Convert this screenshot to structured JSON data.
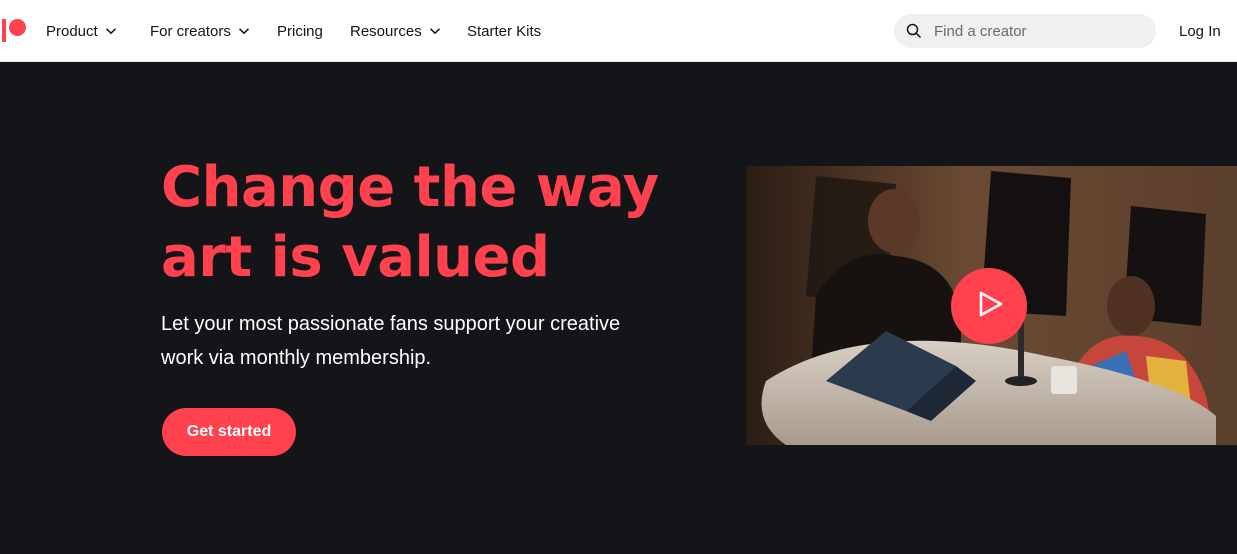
{
  "nav": {
    "brand": "Patreon",
    "items": [
      {
        "label": "Product",
        "has_dropdown": true
      },
      {
        "label": "For creators",
        "has_dropdown": true
      },
      {
        "label": "Pricing",
        "has_dropdown": false
      },
      {
        "label": "Resources",
        "has_dropdown": true
      },
      {
        "label": "Starter Kits",
        "has_dropdown": false
      }
    ],
    "search_placeholder": "Find a creator",
    "search_icon": "search-icon",
    "login_label": "Log In"
  },
  "hero": {
    "headline_line1": "Change the way",
    "headline_line2": "art is valued",
    "subtext_line1": "Let your most passionate fans support your creative",
    "subtext_line2": "work via monthly membership.",
    "cta_label": "Get started",
    "video_play_icon": "play-icon"
  },
  "colors": {
    "brand": "#ff424d",
    "hero_bg": "#141518",
    "nav_bg": "#ffffff",
    "search_bg": "#f1f0ee"
  }
}
